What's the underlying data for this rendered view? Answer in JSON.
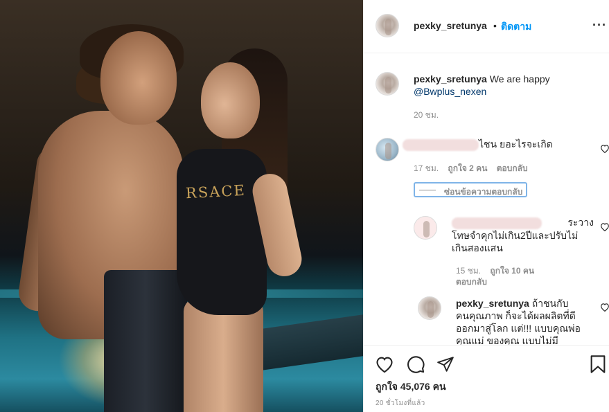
{
  "post": {
    "username": "pexky_sretunya",
    "separator": "•",
    "follow_label": "ติดตาม",
    "more_icon": "more-icon",
    "swimsuit_print": "RSACE"
  },
  "caption": {
    "username": "pexky_sretunya",
    "text": "We are happy",
    "mention": "@Bwplus_nexen",
    "time": "20 ชม."
  },
  "comments": [
    {
      "text": "ไชน ยอะไรจะเกิด",
      "time": "17 ชม.",
      "likes": "ถูกใจ 2 คน",
      "reply": "ตอบกลับ"
    }
  ],
  "replies_toggle": "ซ่อนข้อความตอบกลับ",
  "replies": [
    {
      "line1": "ระวาง",
      "line2": "โทษจำคุกไม่เกิน2ปีและปรับไม่",
      "line3": "เกินสองแสน",
      "time": "15 ชม.",
      "likes": "ถูกใจ 10 คน",
      "reply": "ตอบกลับ"
    },
    {
      "username": "pexky_sretunya",
      "line1": "ถ้าชนกับ",
      "line2": "คนคุณภาพ ก็จะได้ผลผลิตที่ดี",
      "line3": "ออกมาสู่โลก แต่!!! แบบคุณพ่อ",
      "line4": "คุณแม่ ของคุณ แบบไม่มี"
    }
  ],
  "footer": {
    "likes": "ถูกใจ 45,076 คน",
    "time": "20 ชั่วโมงที่แล้ว"
  },
  "colors": {
    "link_blue": "#0095f6",
    "text": "#262626",
    "muted": "#8e8e8e"
  }
}
